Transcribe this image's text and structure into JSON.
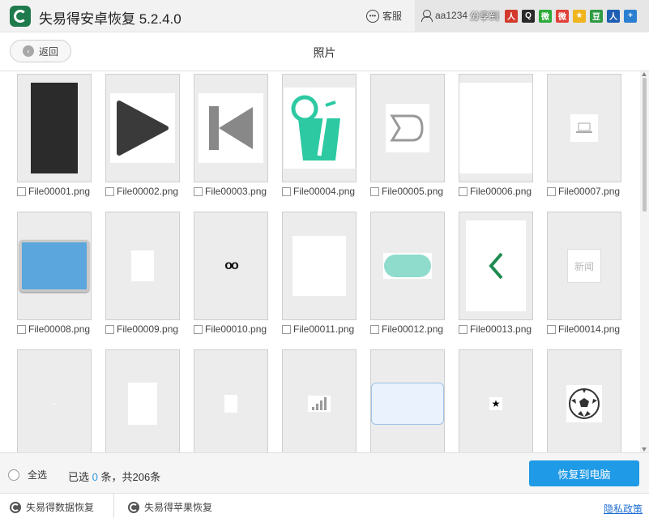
{
  "app": {
    "title": "失易得安卓恢复  5.2.4.0"
  },
  "titlebar": {
    "service_label": "客服",
    "username": "aa1234",
    "share_label": "分享到",
    "share_icons": [
      {
        "name": "renren-share-icon",
        "glyph": "人",
        "color": "#d33a2c"
      },
      {
        "name": "qq-share-icon",
        "glyph": "Q",
        "color": "#2a2a2a"
      },
      {
        "name": "wechat-share-icon",
        "glyph": "微",
        "color": "#2dab3a"
      },
      {
        "name": "weibo-share-icon",
        "glyph": "微",
        "color": "#e0413a"
      },
      {
        "name": "qzone-share-icon",
        "glyph": "★",
        "color": "#f0b51d"
      },
      {
        "name": "douban-share-icon",
        "glyph": "豆",
        "color": "#2e9a43"
      },
      {
        "name": "renren2-share-icon",
        "glyph": "人",
        "color": "#1f5fb3"
      },
      {
        "name": "more-share-icon",
        "glyph": "+",
        "color": "#2b7fd1"
      }
    ]
  },
  "subheader": {
    "back_label": "返回",
    "title": "照片"
  },
  "files": [
    {
      "name": "File00001.png",
      "kind": "phone"
    },
    {
      "name": "File00002.png",
      "kind": "play"
    },
    {
      "name": "File00003.png",
      "kind": "prev"
    },
    {
      "name": "File00004.png",
      "kind": "drink"
    },
    {
      "name": "File00005.png",
      "kind": "tag"
    },
    {
      "name": "File00006.png",
      "kind": "white-large"
    },
    {
      "name": "File00007.png",
      "kind": "laptop"
    },
    {
      "name": "File00008.png",
      "kind": "blue-card"
    },
    {
      "name": "File00009.png",
      "kind": "white-small"
    },
    {
      "name": "File00010.png",
      "kind": "voicemail"
    },
    {
      "name": "File00011.png",
      "kind": "white-square"
    },
    {
      "name": "File00012.png",
      "kind": "pill"
    },
    {
      "name": "File00013.png",
      "kind": "chevron"
    },
    {
      "name": "File00014.png",
      "kind": "news"
    },
    {
      "name": "",
      "kind": "blank"
    },
    {
      "name": "",
      "kind": "white-portrait"
    },
    {
      "name": "",
      "kind": "white-tiny"
    },
    {
      "name": "",
      "kind": "signal"
    },
    {
      "name": "",
      "kind": "light-blue-card"
    },
    {
      "name": "",
      "kind": "star"
    },
    {
      "name": "",
      "kind": "soccer"
    }
  ],
  "bottombar": {
    "select_all_label": "全选",
    "selected_prefix": "已选",
    "selected_count": "0",
    "selected_suffix": "条，共206条",
    "recover_label": "恢复到电脑"
  },
  "footer": {
    "data_recovery_label": "失易得数据恢复",
    "apple_recovery_label": "失易得苹果恢复",
    "privacy_label": "隐私政策"
  }
}
